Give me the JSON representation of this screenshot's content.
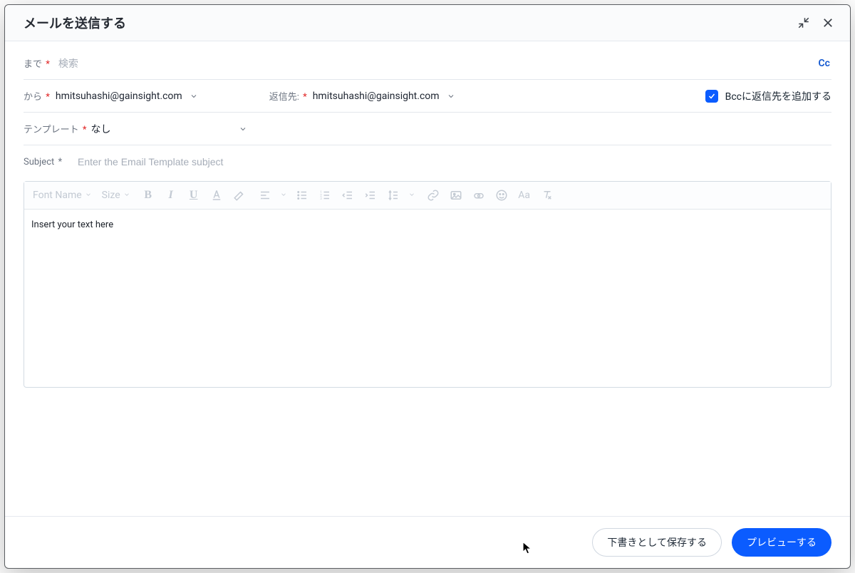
{
  "header": {
    "title": "メールを送信する"
  },
  "fields": {
    "to_label": "まで",
    "to_placeholder": "検索",
    "cc_link": "Cc",
    "from_label": "から",
    "from_value": "hmitsuhashi@gainsight.com",
    "reply_to_label": "返信先:",
    "reply_to_value": "hmitsuhashi@gainsight.com",
    "bcc_check_label": "Bccに返信先を追加する",
    "template_label": "テンプレート",
    "template_value": "なし",
    "subject_label": "Subject",
    "subject_placeholder": "Enter the Email Template subject"
  },
  "toolbar": {
    "font_name": "Font Name",
    "size": "Size"
  },
  "editor": {
    "placeholder": "Insert your text here"
  },
  "footer": {
    "save_draft": "下書きとして保存する",
    "preview": "プレビューする"
  }
}
